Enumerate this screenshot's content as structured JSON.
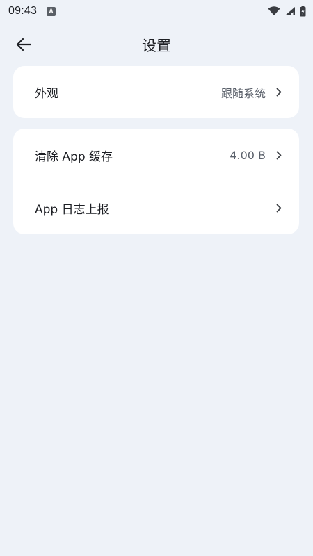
{
  "status_bar": {
    "time": "09:43",
    "app_icon_letter": "A"
  },
  "header": {
    "title": "设置"
  },
  "sections": [
    {
      "items": [
        {
          "label": "外观",
          "value": "跟随系统"
        }
      ]
    },
    {
      "items": [
        {
          "label": "清除 App 缓存",
          "value": "4.00 B"
        },
        {
          "label": "App 日志上报",
          "value": ""
        }
      ]
    }
  ],
  "colors": {
    "background": "#eef2f8",
    "card": "#ffffff",
    "text_primary": "#1d1f24",
    "text_secondary": "#5b616b"
  }
}
